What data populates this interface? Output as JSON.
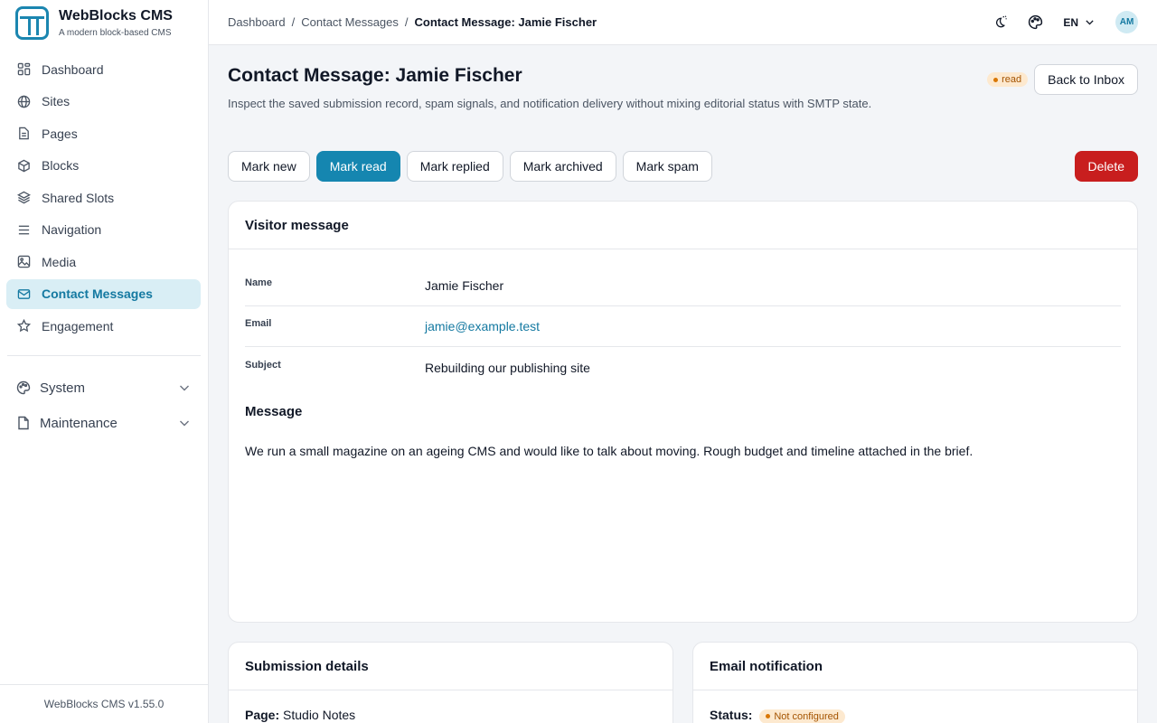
{
  "brand": {
    "title": "WebBlocks CMS",
    "subtitle": "A modern block-based CMS"
  },
  "sidebar": {
    "items": [
      {
        "label": "Dashboard",
        "icon": "grid-icon"
      },
      {
        "label": "Sites",
        "icon": "globe-icon"
      },
      {
        "label": "Pages",
        "icon": "document-icon"
      },
      {
        "label": "Blocks",
        "icon": "cube-icon"
      },
      {
        "label": "Shared Slots",
        "icon": "layers-icon"
      },
      {
        "label": "Navigation",
        "icon": "menu-icon"
      },
      {
        "label": "Media",
        "icon": "image-icon"
      },
      {
        "label": "Contact Messages",
        "icon": "mail-icon",
        "active": true
      },
      {
        "label": "Engagement",
        "icon": "star-icon"
      }
    ],
    "groups": [
      {
        "label": "System",
        "icon": "palette-icon"
      },
      {
        "label": "Maintenance",
        "icon": "file-icon"
      }
    ],
    "footer": "WebBlocks CMS v1.55.0"
  },
  "topbar": {
    "breadcrumbs": [
      "Dashboard",
      "Contact Messages",
      "Contact Message: Jamie Fischer"
    ],
    "separator": "/",
    "language": "EN",
    "avatar": "AM"
  },
  "page": {
    "title": "Contact Message: Jamie Fischer",
    "subtitle": "Inspect the saved submission record, spam signals, and notification delivery without mixing editorial status with SMTP state.",
    "status_badge": "read",
    "back_label": "Back to Inbox"
  },
  "actions": {
    "mark_new": "Mark new",
    "mark_read": "Mark read",
    "mark_replied": "Mark replied",
    "mark_archived": "Mark archived",
    "mark_spam": "Mark spam",
    "delete": "Delete"
  },
  "visitor": {
    "heading": "Visitor message",
    "name_label": "Name",
    "name": "Jamie Fischer",
    "email_label": "Email",
    "email": "jamie@example.test",
    "subject_label": "Subject",
    "subject": "Rebuilding our publishing site",
    "message_label": "Message",
    "message": "We run a small magazine on an ageing CMS and would like to talk about moving. Rough budget and timeline attached in the brief."
  },
  "submission": {
    "heading": "Submission details",
    "page_label": "Page:",
    "page_value": "Studio Notes"
  },
  "notification": {
    "heading": "Email notification",
    "status_label": "Status:",
    "status_value": "Not configured"
  },
  "colors": {
    "accent": "#1586b0",
    "danger": "#c81e1e",
    "warning_bg": "#fde9cf"
  }
}
